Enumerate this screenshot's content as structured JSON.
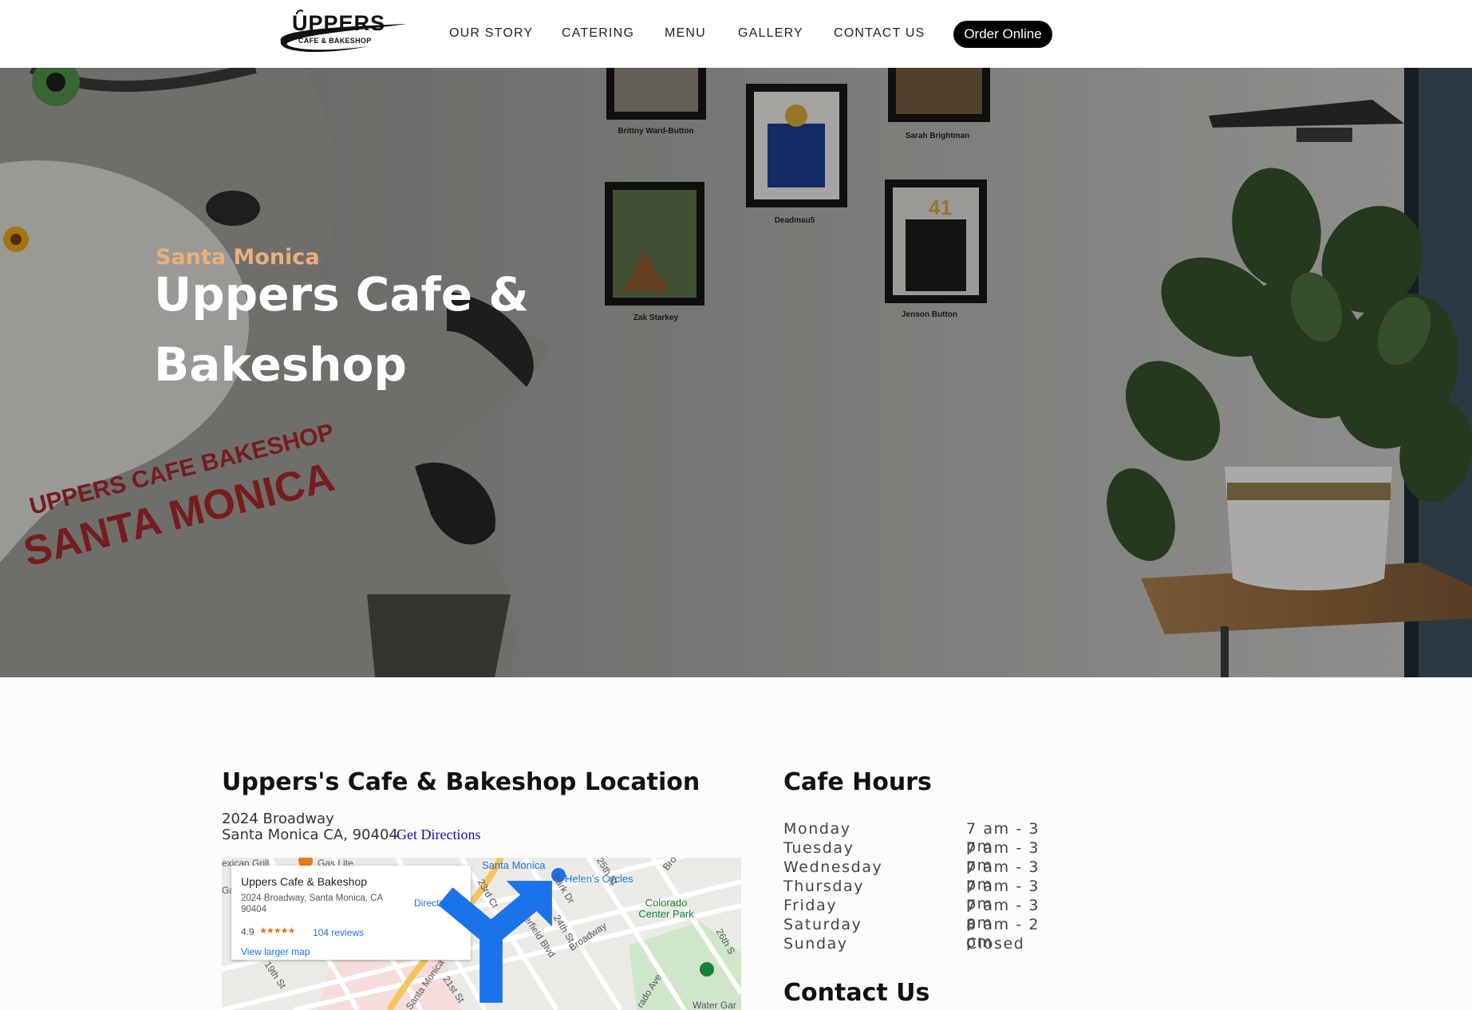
{
  "header": {
    "logo": {
      "word": "UPPERS",
      "sub": "CAFE & BAKESHOP"
    },
    "nav": [
      "OUR STORY",
      "CATERING",
      "MENU",
      "GALLERY",
      "CONTACT US"
    ],
    "order_button": "Order Online"
  },
  "hero": {
    "eyebrow": "Santa Monica",
    "title": "Uppers Cafe & Bakeshop",
    "photo_captions": [
      "Brittny Ward-Button",
      "Sarah Brightman",
      "Deadmau5",
      "Zak Starkey",
      "Jenson Button"
    ],
    "mural_text": [
      "UPPERS CAFE BAKESHOP",
      "SANTA MONICA"
    ]
  },
  "location": {
    "title": "Uppers's Cafe & Bakeshop Location",
    "address_line1": "2024 Broadway",
    "address_line2": "Santa Monica CA, 90404",
    "directions_link": "Get Directions",
    "map": {
      "card_name": "Uppers Cafe & Bakeshop",
      "card_address": "2024 Broadway, Santa Monica, CA 90404",
      "rating": "4.9",
      "stars": "★★★★★",
      "reviews": "104 reviews",
      "larger_map": "View larger map",
      "directions": "Directions",
      "labels": {
        "mexican": "exican Grill",
        "gas": "Gas Lite",
        "santa_monica_top": "Santa Monica",
        "helens": "Helen's Cycles",
        "colorado_park": "Colorado Center Park",
        "st_23rd": "23rd Ct",
        "park_dr": "Park Dr",
        "st_25th": "25th St",
        "cloverfield": "Cloverfield Blvd",
        "st_24th": "24th St",
        "broadway": "Broadway",
        "st_26th": "26th S",
        "st_19th": "19th St",
        "santa_monica_blvd": "Santa Monica",
        "st_21st": "21st St",
        "colorado_ave": "rado Ave",
        "water": "Water Gar",
        "ga": "Ga",
        "st_s": "St",
        "bro": "Bro"
      }
    }
  },
  "hours": {
    "title": "Cafe Hours",
    "rows": [
      {
        "day": "Monday",
        "time": "7 am - 3 pm"
      },
      {
        "day": "Tuesday",
        "time": "7 am - 3 pm"
      },
      {
        "day": "Wednesday",
        "time": "7 am - 3 pm"
      },
      {
        "day": "Thursday",
        "time": "7 am - 3 pm"
      },
      {
        "day": "Friday",
        "time": "7 am - 3 pm"
      },
      {
        "day": "Saturday",
        "time": "8 am - 2 pm"
      },
      {
        "day": "Sunday",
        "time": "Closed"
      }
    ]
  },
  "contact": {
    "title": "Contact Us"
  }
}
